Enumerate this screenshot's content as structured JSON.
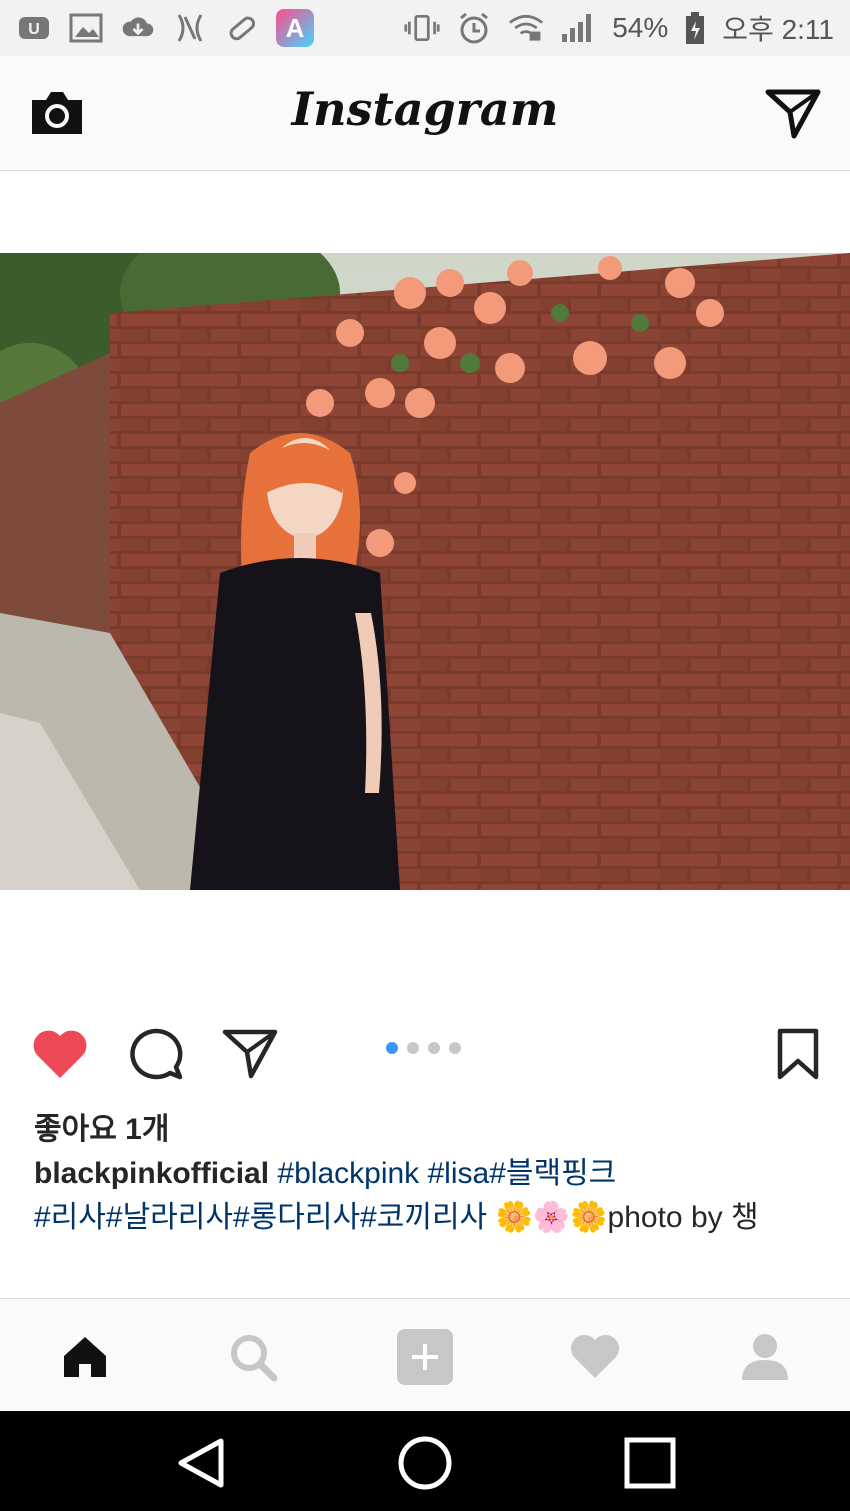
{
  "status_bar": {
    "battery": "54%",
    "time": "오후 2:11"
  },
  "header": {
    "logo": "Instagram"
  },
  "post": {
    "likes": "좋아요 1개",
    "username": "blackpinkofficial",
    "hashtags_line1": " #blackpink #lisa#블랙핑크",
    "hashtags_line2": "#리사#날라리사#롱다리사#코끼리사 ",
    "emojis": "🌼🌸🌼",
    "caption_tail": "photo by 챙",
    "carousel_total": 4,
    "carousel_active": 1
  },
  "tabs": [
    "home-icon",
    "search-icon",
    "add-icon",
    "activity-heart-icon",
    "profile-icon"
  ],
  "colors": {
    "like": "#ed4956",
    "hashtag": "#003569",
    "carousel_active": "#3897f0"
  }
}
